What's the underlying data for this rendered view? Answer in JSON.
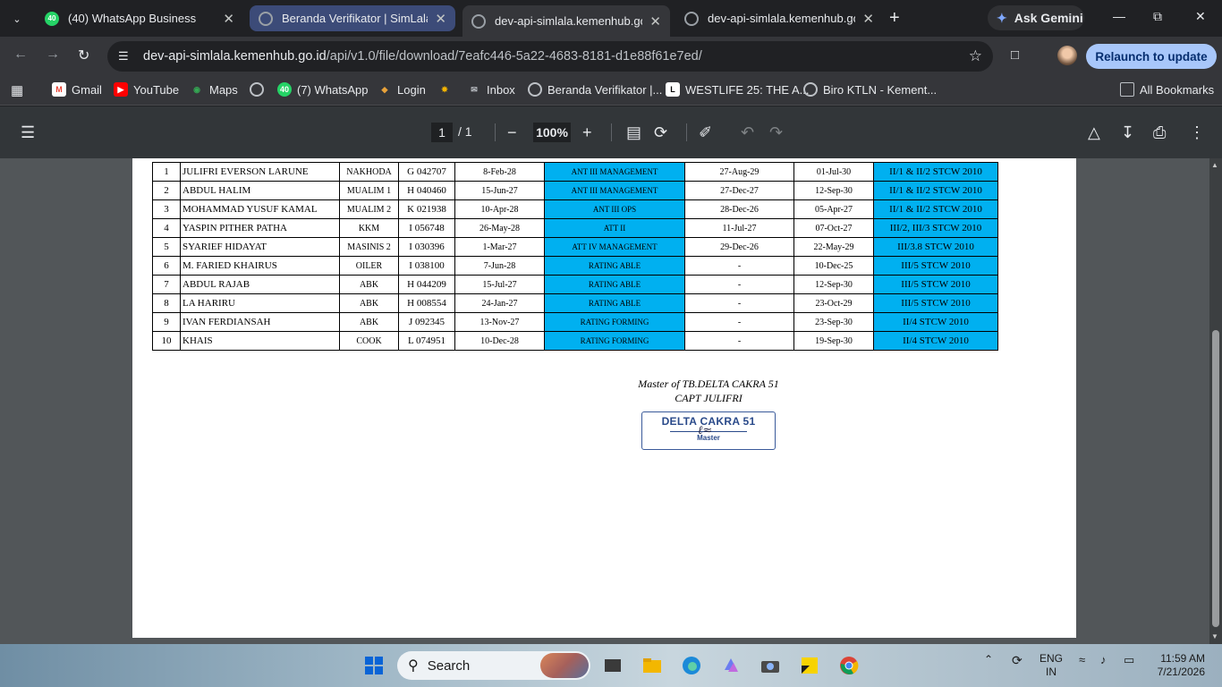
{
  "browser": {
    "tabs": [
      {
        "title": "(40) WhatsApp Business",
        "badge": "40"
      },
      {
        "title": "Beranda Verifikator | SimLala"
      },
      {
        "title": "dev-api-simlala.kemenhub.go.id"
      },
      {
        "title": "dev-api-simlala.kemenhub.go.id"
      }
    ],
    "gemini_label": "Ask Gemini",
    "url_host": "dev-api-simlala.kemenhub.go.id",
    "url_path": "/api/v1.0/file/download/7eafc446-5a22-4683-8181-d1e88f61e7ed/",
    "relaunch_label": "Relaunch to update",
    "bookmarks": [
      {
        "label": "Gmail"
      },
      {
        "label": "YouTube"
      },
      {
        "label": "Maps"
      },
      {
        "label": "(7) WhatsApp"
      },
      {
        "label": "Login"
      },
      {
        "label": "Inbox"
      },
      {
        "label": "Beranda Verifikator |..."
      },
      {
        "label": "WESTLIFE 25: THE A..."
      },
      {
        "label": "Biro KTLN - Kement..."
      }
    ],
    "all_bookmarks_label": "All Bookmarks",
    "whatsapp_badge": "40"
  },
  "pdf_toolbar": {
    "page_current": "1",
    "page_total": "/  1",
    "zoom": "100%"
  },
  "crew_table": {
    "rows": [
      {
        "no": "1",
        "name": "JULIFRI EVERSON LARUNE",
        "rank": "NAKHODA",
        "book": "G 042707",
        "expiry": "8-Feb-28",
        "cert": "ANT III MANAGEMENT",
        "date1": "27-Aug-29",
        "date2": "01-Jul-30",
        "stcw": "II/1 & II/2 STCW 2010"
      },
      {
        "no": "2",
        "name": "ABDUL HALIM",
        "rank": "MUALIM 1",
        "book": "H 040460",
        "expiry": "15-Jun-27",
        "cert": "ANT III MANAGEMENT",
        "date1": "27-Dec-27",
        "date2": "12-Sep-30",
        "stcw": "II/1 & II/2 STCW 2010"
      },
      {
        "no": "3",
        "name": "MOHAMMAD YUSUF KAMAL",
        "rank": "MUALIM 2",
        "book": "K 021938",
        "expiry": "10-Apr-28",
        "cert": "ANT III OPS",
        "date1": "28-Dec-26",
        "date2": "05-Apr-27",
        "stcw": "II/1 & II/2 STCW 2010"
      },
      {
        "no": "4",
        "name": "YASPIN PITHER PATHA",
        "rank": "KKM",
        "book": "I 056748",
        "expiry": "26-May-28",
        "cert": "ATT II",
        "date1": "11-Jul-27",
        "date2": "07-Oct-27",
        "stcw": "III/2, III/3 STCW 2010"
      },
      {
        "no": "5",
        "name": "SYARIEF HIDAYAT",
        "rank": "MASINIS 2",
        "book": "I 030396",
        "expiry": "1-Mar-27",
        "cert": "ATT IV MANAGEMENT",
        "date1": "29-Dec-26",
        "date2": "22-May-29",
        "stcw": "III/3.8 STCW 2010"
      },
      {
        "no": "6",
        "name": "M. FARIED KHAIRUS",
        "rank": "OILER",
        "book": "I 038100",
        "expiry": "7-Jun-28",
        "cert": "RATING ABLE",
        "date1": "-",
        "date2": "10-Dec-25",
        "stcw": "III/5 STCW 2010"
      },
      {
        "no": "7",
        "name": "ABDUL RAJAB",
        "rank": "ABK",
        "book": "H 044209",
        "expiry": "15-Jul-27",
        "cert": "RATING ABLE",
        "date1": "-",
        "date2": "12-Sep-30",
        "stcw": "III/5 STCW 2010"
      },
      {
        "no": "8",
        "name": "LA HARIRU",
        "rank": "ABK",
        "book": "H 008554",
        "expiry": "24-Jan-27",
        "cert": "RATING ABLE",
        "date1": "-",
        "date2": "23-Oct-29",
        "stcw": "III/5 STCW 2010"
      },
      {
        "no": "9",
        "name": "IVAN FERDIANSAH",
        "rank": "ABK",
        "book": "J 092345",
        "expiry": "13-Nov-27",
        "cert": "RATING FORMING",
        "date1": "-",
        "date2": "23-Sep-30",
        "stcw": "II/4 STCW 2010"
      },
      {
        "no": "10",
        "name": "KHAIS",
        "rank": "COOK",
        "book": "L 074951",
        "expiry": "10-Dec-28",
        "cert": "RATING FORMING",
        "date1": "-",
        "date2": "19-Sep-30",
        "stcw": "II/4 STCW 2010"
      }
    ]
  },
  "signature": {
    "line1": "Master of TB.DELTA  CAKRA  51",
    "line2": "CAPT JULIFRI",
    "stamp_name": "DELTA CAKRA 51",
    "stamp_role": "Master"
  },
  "taskbar": {
    "search_label": "Search",
    "lang_line1": "ENG",
    "lang_line2": "IN",
    "time": "11:59 AM",
    "date": "7/21/2026"
  },
  "colors": {
    "cert_cell": "#00b0f0",
    "relaunch_bg": "#a8c7fa"
  }
}
